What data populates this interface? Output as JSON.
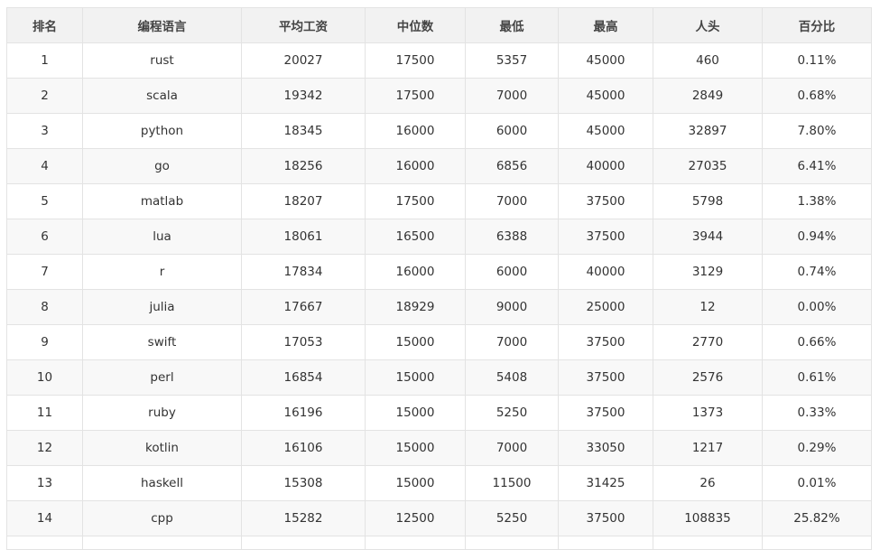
{
  "table": {
    "headers": [
      "排名",
      "编程语言",
      "平均工资",
      "中位数",
      "最低",
      "最高",
      "人头",
      "百分比"
    ],
    "rows": [
      [
        "1",
        "rust",
        "20027",
        "17500",
        "5357",
        "45000",
        "460",
        "0.11%"
      ],
      [
        "2",
        "scala",
        "19342",
        "17500",
        "7000",
        "45000",
        "2849",
        "0.68%"
      ],
      [
        "3",
        "python",
        "18345",
        "16000",
        "6000",
        "45000",
        "32897",
        "7.80%"
      ],
      [
        "4",
        "go",
        "18256",
        "16000",
        "6856",
        "40000",
        "27035",
        "6.41%"
      ],
      [
        "5",
        "matlab",
        "18207",
        "17500",
        "7000",
        "37500",
        "5798",
        "1.38%"
      ],
      [
        "6",
        "lua",
        "18061",
        "16500",
        "6388",
        "37500",
        "3944",
        "0.94%"
      ],
      [
        "7",
        "r",
        "17834",
        "16000",
        "6000",
        "40000",
        "3129",
        "0.74%"
      ],
      [
        "8",
        "julia",
        "17667",
        "18929",
        "9000",
        "25000",
        "12",
        "0.00%"
      ],
      [
        "9",
        "swift",
        "17053",
        "15000",
        "7000",
        "37500",
        "2770",
        "0.66%"
      ],
      [
        "10",
        "perl",
        "16854",
        "15000",
        "5408",
        "37500",
        "2576",
        "0.61%"
      ],
      [
        "11",
        "ruby",
        "16196",
        "15000",
        "5250",
        "37500",
        "1373",
        "0.33%"
      ],
      [
        "12",
        "kotlin",
        "16106",
        "15000",
        "7000",
        "33050",
        "1217",
        "0.29%"
      ],
      [
        "13",
        "haskell",
        "15308",
        "15000",
        "11500",
        "31425",
        "26",
        "0.01%"
      ],
      [
        "14",
        "cpp",
        "15282",
        "12500",
        "5250",
        "37500",
        "108835",
        "25.82%"
      ]
    ]
  }
}
